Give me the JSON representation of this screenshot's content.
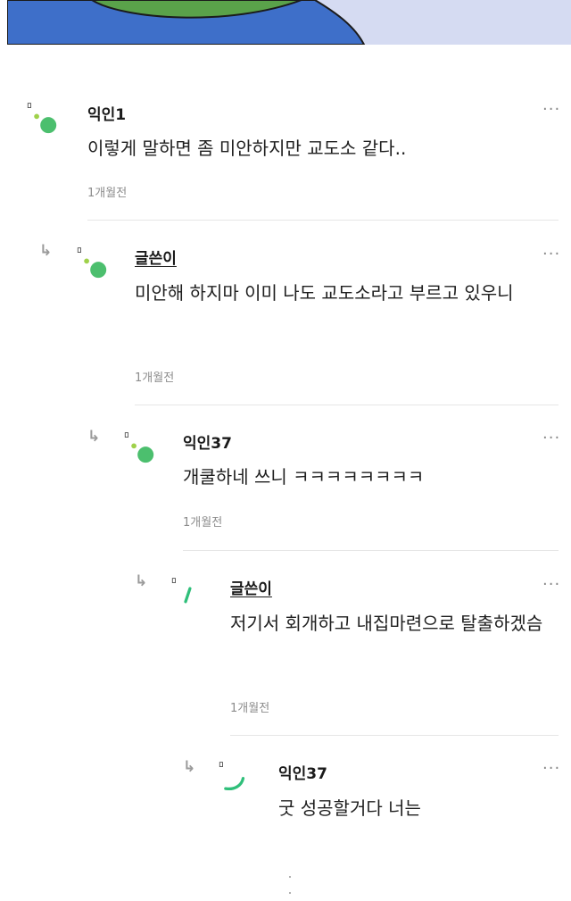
{
  "comments": [
    {
      "author": "익인1",
      "text": "이렇게 말하면 좀 미안하지만 교도소 같다..",
      "time": "1개월전",
      "more": "···",
      "avatar": "green-dots"
    },
    {
      "author": "글쓴이",
      "text": "미안해 하지마 이미 나도 교도소라고 부르고 있우니",
      "time": "1개월전",
      "more": "···",
      "avatar": "green-dots",
      "reply_icon": "↳"
    },
    {
      "author": "익인37",
      "text": "개쿨하네 쓰니 ㅋㅋㅋㅋㅋㅋㅋㅋ",
      "time": "1개월전",
      "more": "···",
      "avatar": "green-dots",
      "reply_icon": "↳"
    },
    {
      "author": "글쓴이",
      "text": "저기서 회개하고 내집마련으로 탈출하겠슴",
      "time": "1개월전",
      "more": "···",
      "avatar": "loading-arc",
      "reply_icon": "↳"
    },
    {
      "author": "익인37",
      "text": "굿 성공할거다 너는",
      "more": "···",
      "avatar": "loading-arc",
      "reply_icon": "↳"
    }
  ],
  "colors": {
    "accent_green": "#4cbf6e",
    "light_green": "#9fd14a",
    "banner_blue": "#3e6fc9",
    "banner_bg": "#d5dbf2"
  }
}
